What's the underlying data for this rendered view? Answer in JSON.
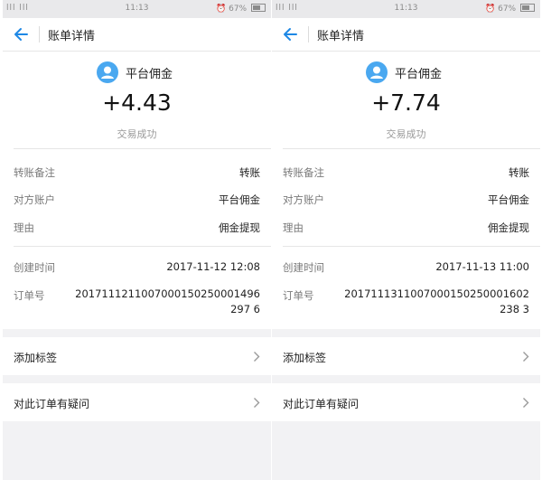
{
  "panels": [
    {
      "status_bar": {
        "signal": "lll lll",
        "time": "11:13",
        "battery": "67%"
      },
      "header": {
        "title": "账单详情"
      },
      "summary": {
        "payee": "平台佣金",
        "amount": "+4.43",
        "status": "交易成功"
      },
      "details": [
        {
          "label": "转账备注",
          "value": "转账"
        },
        {
          "label": "对方账户",
          "value": "平台佣金"
        },
        {
          "label": "理由",
          "value": "佣金提现"
        }
      ],
      "meta": {
        "created_label": "创建时间",
        "created_value": "2017-11-12 12:08",
        "order_label": "订单号",
        "order_value": "2017111211007000150250001496297 6"
      },
      "actions": {
        "tag_label": "添加标签",
        "question_label": "对此订单有疑问"
      }
    },
    {
      "status_bar": {
        "signal": "lll lll",
        "time": "11:13",
        "battery": "67%"
      },
      "header": {
        "title": "账单详情"
      },
      "summary": {
        "payee": "平台佣金",
        "amount": "+7.74",
        "status": "交易成功"
      },
      "details": [
        {
          "label": "转账备注",
          "value": "转账"
        },
        {
          "label": "对方账户",
          "value": "平台佣金"
        },
        {
          "label": "理由",
          "value": "佣金提现"
        }
      ],
      "meta": {
        "created_label": "创建时间",
        "created_value": "2017-11-13 11:00",
        "order_label": "订单号",
        "order_value": "2017111311007000150250001602238 3"
      },
      "actions": {
        "tag_label": "添加标签",
        "question_label": "对此订单有疑问"
      }
    }
  ],
  "colors": {
    "accent": "#1e88e5",
    "avatar": "#4aa8f0",
    "background": "#f2f2f4"
  },
  "icons": [
    "back-arrow-icon",
    "user-avatar-icon",
    "chevron-right-icon",
    "alarm-icon",
    "battery-icon"
  ]
}
